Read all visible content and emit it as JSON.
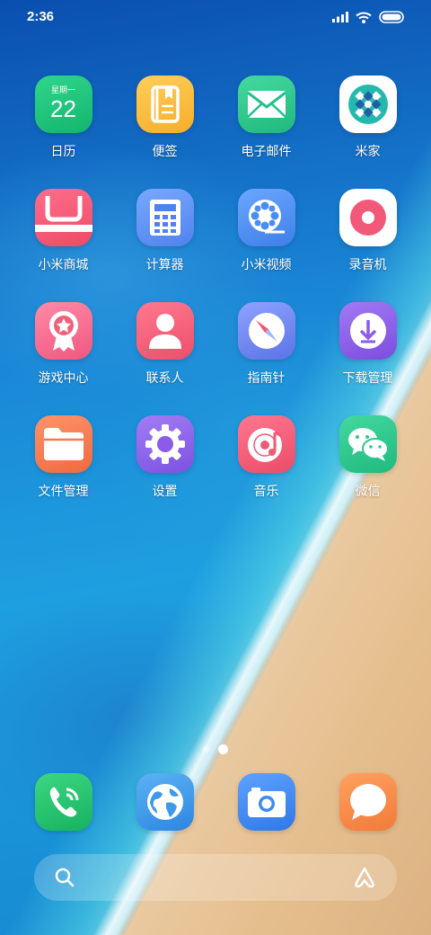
{
  "status_bar": {
    "time": "2:36",
    "icons": [
      "signal-icon",
      "wifi-icon",
      "battery-icon"
    ]
  },
  "apps": [
    [
      {
        "name": "calendar",
        "label": "日历",
        "icon": "calendar-icon",
        "weekday": "星期一",
        "day": "22",
        "color": "#19c07a"
      },
      {
        "name": "notes",
        "label": "便签",
        "icon": "notes-icon",
        "color": "#f7b733"
      },
      {
        "name": "email",
        "label": "电子邮件",
        "icon": "envelope-icon",
        "color": "#2ec98f"
      },
      {
        "name": "mijia",
        "label": "米家",
        "icon": "mijia-icon",
        "color": "#ffffff"
      }
    ],
    [
      {
        "name": "mi-store",
        "label": "小米商城",
        "icon": "shopping-bag-icon",
        "color": "#f05a75"
      },
      {
        "name": "calculator",
        "label": "计算器",
        "icon": "calculator-icon",
        "color": "#5c8ff0"
      },
      {
        "name": "mi-video",
        "label": "小米视频",
        "icon": "film-reel-icon",
        "color": "#4a8df0"
      },
      {
        "name": "recorder",
        "label": "录音机",
        "icon": "record-icon",
        "color": "#ffffff"
      }
    ],
    [
      {
        "name": "game-center",
        "label": "游戏中心",
        "icon": "award-icon",
        "color": "#f0608a"
      },
      {
        "name": "contacts",
        "label": "联系人",
        "icon": "person-icon",
        "color": "#f0607a"
      },
      {
        "name": "compass",
        "label": "指南针",
        "icon": "compass-icon",
        "color": "#6c84ee"
      },
      {
        "name": "downloads",
        "label": "下载管理",
        "icon": "download-icon",
        "color": "#8a5ce8"
      }
    ],
    [
      {
        "name": "file-manager",
        "label": "文件管理",
        "icon": "folder-icon",
        "color": "#f47a4c"
      },
      {
        "name": "settings",
        "label": "设置",
        "icon": "gear-icon",
        "color": "#8a5ce8"
      },
      {
        "name": "music",
        "label": "音乐",
        "icon": "music-disc-icon",
        "color": "#f05a75"
      },
      {
        "name": "wechat",
        "label": "微信",
        "icon": "wechat-icon",
        "color": "#2ec98f"
      }
    ]
  ],
  "dock": [
    {
      "name": "phone",
      "icon": "phone-icon",
      "color": "#22c06e"
    },
    {
      "name": "browser",
      "icon": "globe-icon",
      "color": "#3e9ae8"
    },
    {
      "name": "camera",
      "icon": "camera-icon",
      "color": "#3e8cf0"
    },
    {
      "name": "messages",
      "icon": "message-icon",
      "color": "#f5894a"
    }
  ],
  "page_indicator": {
    "pages": 2,
    "current": 2
  },
  "search_bar": {
    "icons": [
      "search-icon",
      "assistant-icon"
    ]
  }
}
